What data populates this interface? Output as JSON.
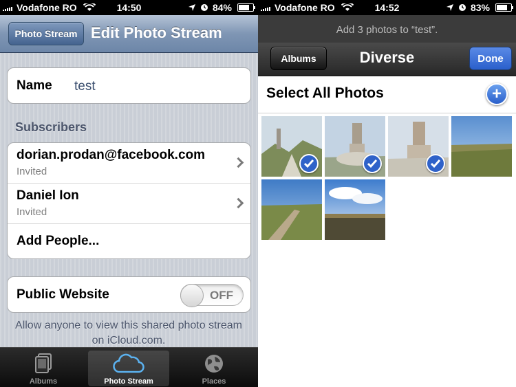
{
  "left": {
    "status": {
      "carrier": "Vodafone RO",
      "time": "14:50",
      "battery": "84%",
      "battery_level": 0.84
    },
    "nav": {
      "back_label": "Photo Stream",
      "title": "Edit Photo Stream"
    },
    "name": {
      "label": "Name",
      "value": "test"
    },
    "subscribers_header": "Subscribers",
    "subscribers": [
      {
        "email": "dorian.prodan@facebook.com",
        "status": "Invited"
      },
      {
        "email": "Daniel Ion",
        "status": "Invited"
      }
    ],
    "add_people": "Add People...",
    "public_website": {
      "label": "Public Website",
      "toggle": "OFF"
    },
    "footnote": "Allow anyone to view this shared photo stream on iCloud.com.",
    "tabs": [
      {
        "label": "Albums",
        "icon": "albums-icon"
      },
      {
        "label": "Photo Stream",
        "icon": "cloud-icon",
        "active": true
      },
      {
        "label": "Places",
        "icon": "globe-icon"
      }
    ]
  },
  "right": {
    "status": {
      "carrier": "Vodafone RO",
      "time": "14:52",
      "battery": "83%",
      "battery_level": 0.83
    },
    "prompt": "Add 3 photos to “test”.",
    "nav": {
      "back_label": "Albums",
      "title": "Diverse",
      "done_label": "Done"
    },
    "select_all": "Select All Photos",
    "photos": [
      {
        "selected": true
      },
      {
        "selected": true
      },
      {
        "selected": true
      },
      {
        "selected": false
      },
      {
        "selected": false
      },
      {
        "selected": false
      }
    ]
  }
}
